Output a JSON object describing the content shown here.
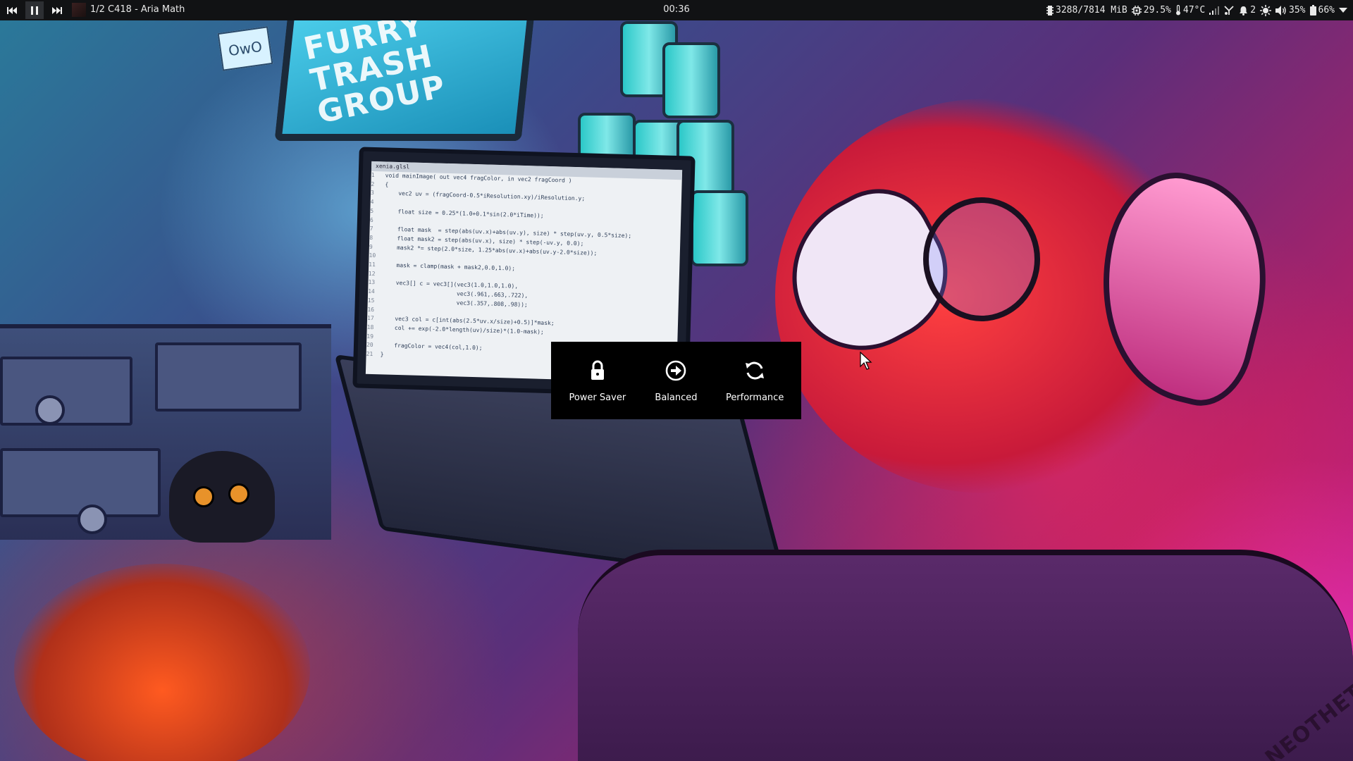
{
  "topbar": {
    "media": {
      "prev_icon": "skip-back-icon",
      "play_pause_icon": "pause-icon",
      "next_icon": "skip-forward-icon",
      "track_label": "1/2  C418 - Aria Math"
    },
    "clock": "00:36",
    "status": {
      "memory": "3288/7814 MiB",
      "cpu": "29.5%",
      "temperature": "47°C",
      "notifications": "2",
      "volume": "35%",
      "battery": "66%"
    }
  },
  "wallpaper": {
    "monitor_text": "FURRY TRASH GROUP",
    "sticky_note": "OwO",
    "signature": "NEOTHETA",
    "code_tab": "xenia.glsl",
    "code_lines": [
      "void mainImage( out vec4 fragColor, in vec2 fragCoord )",
      "{",
      "    vec2 uv = (fragCoord-0.5*iResolution.xy)/iResolution.y;",
      "",
      "    float size = 0.25*(1.0+0.1*sin(2.0*iTime));",
      "",
      "    float mask  = step(abs(uv.x)+abs(uv.y), size) * step(uv.y, 0.5*size);",
      "    float mask2 = step(abs(uv.x), size) * step(-uv.y, 0.0);",
      "    mask2 *= step(2.0*size, 1.25*abs(uv.x)+abs(uv.y-2.0*size));",
      "",
      "    mask = clamp(mask + mask2,0.0,1.0);",
      "",
      "    vec3[] c = vec3[](vec3(1.0,1.0,1.0),",
      "                      vec3(.961,.663,.722),",
      "                      vec3(.357,.808,.98));",
      "",
      "    vec3 col = c[int(abs(2.5*uv.x/size)+0.5)]*mask;",
      "    col += exp(-2.0*length(uv)/size)*(1.0-mask);",
      "",
      "    fragColor = vec4(col,1.0);",
      "}"
    ]
  },
  "power_menu": {
    "options": [
      {
        "label": "Power Saver",
        "icon": "lock-icon"
      },
      {
        "label": "Balanced",
        "icon": "arrow-circle-icon"
      },
      {
        "label": "Performance",
        "icon": "refresh-icon"
      }
    ]
  },
  "colors": {
    "bar_bg": "#111214",
    "menu_bg": "#000000",
    "text": "#e8e8e8"
  }
}
